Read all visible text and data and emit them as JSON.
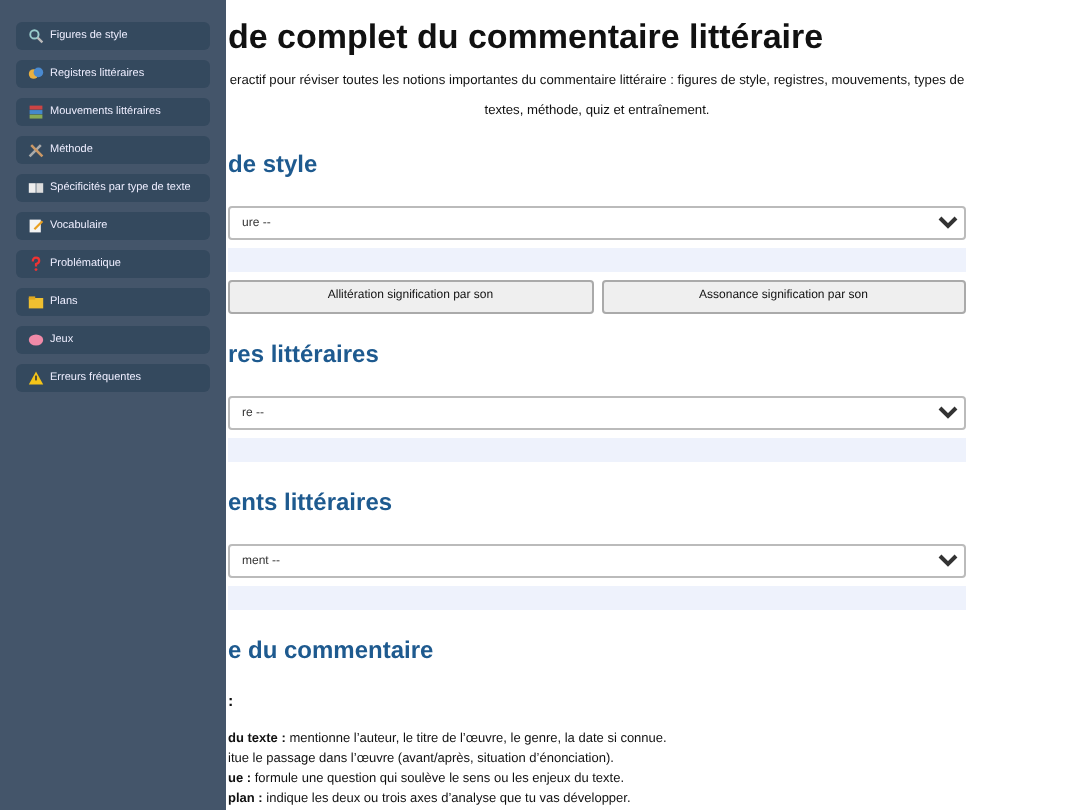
{
  "sidebar": {
    "items": [
      {
        "label": "Figures de style"
      },
      {
        "label": "Registres littéraires"
      },
      {
        "label": "Mouvements littéraires"
      },
      {
        "label": "Méthode"
      },
      {
        "label": "Spécificités par type de texte"
      },
      {
        "label": "Vocabulaire"
      },
      {
        "label": "Problématique"
      },
      {
        "label": "Plans"
      },
      {
        "label": "Jeux"
      },
      {
        "label": "Erreurs fréquentes"
      }
    ]
  },
  "page": {
    "title": "de complet du commentaire littéraire",
    "intro": "eractif pour réviser toutes les notions importantes du commentaire littéraire : figures de style, registres, mouvements, types de textes, méthode, quiz et entraînement."
  },
  "sections": [
    {
      "kind": "select",
      "heading": "de style",
      "placeholder": "ure --",
      "buttons": [
        "Allitération signification par son",
        "Assonance signification par son"
      ]
    },
    {
      "kind": "select",
      "heading": "res littéraires",
      "placeholder": "re --"
    },
    {
      "kind": "select",
      "heading": "ents littéraires",
      "placeholder": "ment --"
    },
    {
      "kind": "method",
      "heading": "e du commentaire",
      "subheading": ":",
      "points": [
        "**du texte :** mentionne l’auteur, le titre de l’œuvre, le genre, la date si connue.",
        "itue le passage dans l’œuvre (avant/après, situation d’énonciation).",
        "**ue :** formule une question qui soulève le sens ou les enjeux du texte.",
        "**plan :** indique les deux ou trois axes d’analyse que tu vas développer."
      ]
    }
  ]
}
